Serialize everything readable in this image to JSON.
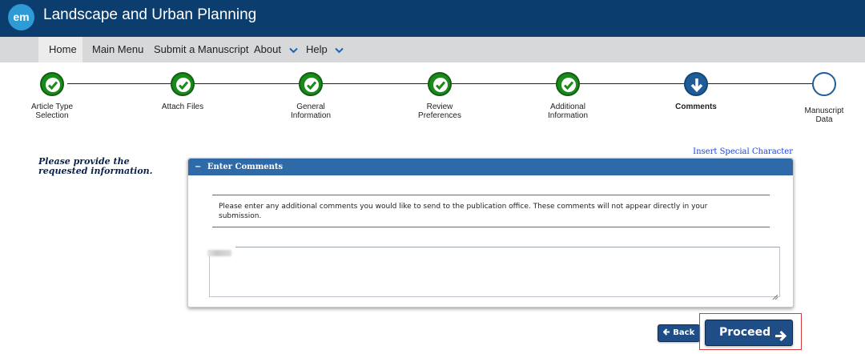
{
  "header": {
    "logo_text": "em",
    "journal_title": "Landscape and Urban Planning"
  },
  "nav": {
    "items": [
      {
        "label": "Home",
        "active": true
      },
      {
        "label": "Main Menu"
      },
      {
        "label": "Submit a Manuscript"
      },
      {
        "label": "About",
        "dropdown": true
      },
      {
        "label": "Help",
        "dropdown": true
      }
    ]
  },
  "steps": [
    {
      "label": "Article Type\nSelection",
      "status": "done"
    },
    {
      "label": "Attach Files",
      "status": "done"
    },
    {
      "label": "General\nInformation",
      "status": "done"
    },
    {
      "label": "Review\nPreferences",
      "status": "done"
    },
    {
      "label": "Additional\nInformation",
      "status": "done"
    },
    {
      "label": "Comments",
      "status": "current"
    },
    {
      "label": "Manuscript\nData",
      "status": "todo"
    }
  ],
  "instruction": "Please provide the requested information.",
  "insert_special_character": "Insert Special Character",
  "panel": {
    "title": "Enter Comments",
    "description": "Please enter any additional comments you would like to send to the publication office. These comments will not appear directly in your submission.",
    "comment_value": ""
  },
  "buttons": {
    "back_label": "Back",
    "proceed_label": "Proceed"
  },
  "colors": {
    "header": "#0b3e6f",
    "nav": "#d6d8da",
    "done": "#1a8a1a",
    "current": "#1f5c9a",
    "panel_header": "#2f6aa8",
    "button": "#1f4e86",
    "highlight": "#d33a3a"
  }
}
